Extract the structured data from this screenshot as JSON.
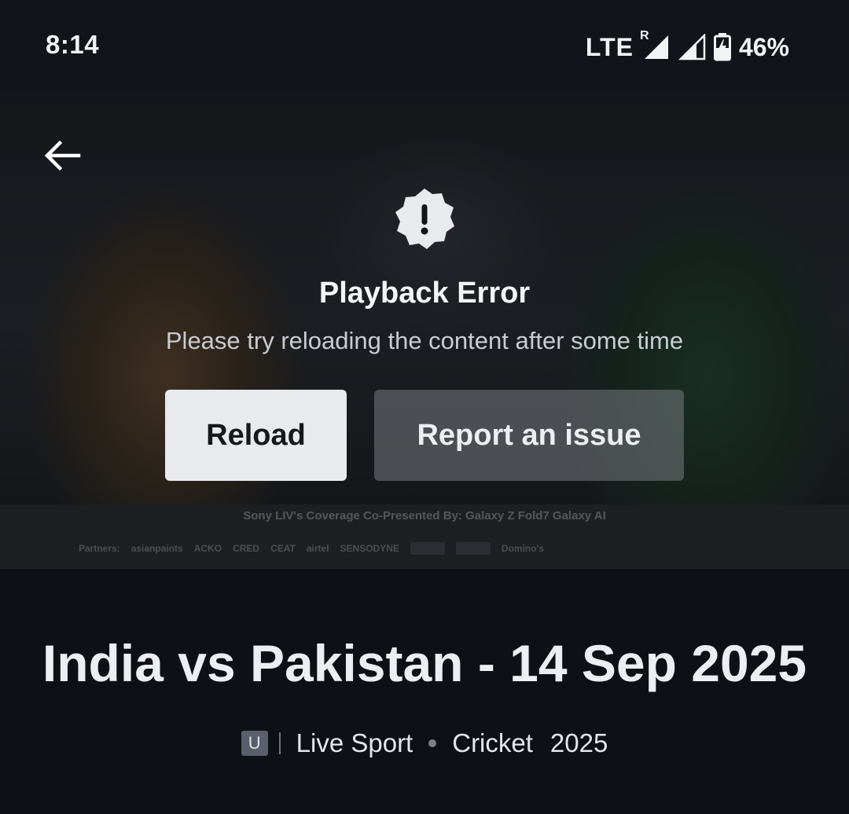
{
  "status_bar": {
    "time": "8:14",
    "network": "LTE",
    "roaming": "R",
    "battery": "46%",
    "battery_level": 0.46,
    "icons": [
      "signal-roaming-icon",
      "signal-icon",
      "battery-charging-icon"
    ]
  },
  "player": {
    "back_icon": "arrow-left-icon",
    "error_icon": "alert-badge-icon",
    "error_title": "Playback Error",
    "error_message": "Please try reloading the content after some time",
    "reload_label": "Reload",
    "report_label": "Report an issue",
    "sponsor_row1": "Sony LIV's Coverage   Co-Presented By:   Galaxy Z Fold7 Galaxy AI",
    "sponsor_row2": [
      "Partners:",
      "asianpaints",
      "ACKO",
      "CRED",
      "CEAT",
      "airtel",
      "SENSODYNE",
      "Domino's"
    ]
  },
  "content": {
    "title": "India vs Pakistan - 14 Sep 2025",
    "rating": "U",
    "genre": "Live Sport",
    "sport": "Cricket",
    "year": "2025"
  },
  "colors": {
    "background": "#0d1014",
    "reload_button": "#e9eaee",
    "report_button": "#787a80"
  }
}
